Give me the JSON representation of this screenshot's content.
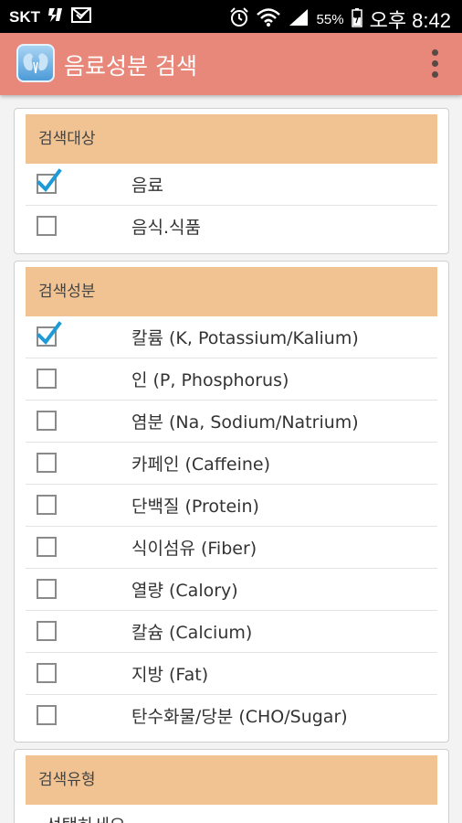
{
  "status_bar": {
    "carrier": "SKT",
    "battery": "55%",
    "time": "오후 8:42"
  },
  "app_bar": {
    "title": "음료성분 검색",
    "icon": "kidney-app-icon",
    "menu_icon": "overflow-menu-icon"
  },
  "search_target": {
    "header": "검색대상",
    "items": [
      {
        "label": "음료",
        "checked": true
      },
      {
        "label": "음식.식품",
        "checked": false
      }
    ]
  },
  "search_components": {
    "header": "검색성분",
    "items": [
      {
        "label": "칼륨 (K, Potassium/Kalium)",
        "checked": true
      },
      {
        "label": "인 (P, Phosphorus)",
        "checked": false
      },
      {
        "label": "염분 (Na, Sodium/Natrium)",
        "checked": false
      },
      {
        "label": "카페인 (Caffeine)",
        "checked": false
      },
      {
        "label": "단백질 (Protein)",
        "checked": false
      },
      {
        "label": "식이섬유 (Fiber)",
        "checked": false
      },
      {
        "label": "열량 (Calory)",
        "checked": false
      },
      {
        "label": "칼슘 (Calcium)",
        "checked": false
      },
      {
        "label": "지방 (Fat)",
        "checked": false
      },
      {
        "label": "탄수화물/당분 (CHO/Sugar)",
        "checked": false
      }
    ]
  },
  "search_type": {
    "header": "검색유형",
    "peek_text": "선택하세요"
  },
  "colors": {
    "app_bar": "#e8887a",
    "section_header": "#f1c392",
    "check_mark": "#1e9ad6"
  }
}
